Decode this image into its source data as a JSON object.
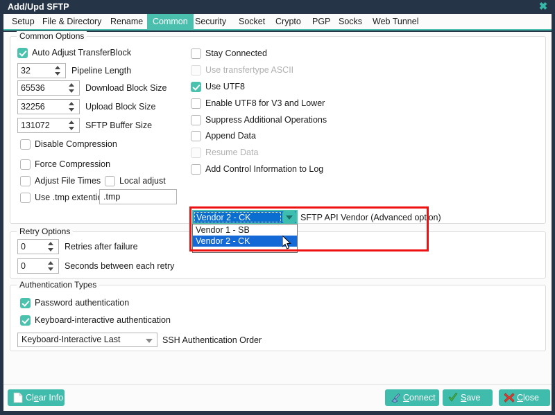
{
  "window": {
    "title": "Add/Upd SFTP",
    "close_icon": "close-x-icon"
  },
  "tabs": [
    {
      "label": "Setup",
      "active": false
    },
    {
      "label": "File & Directory",
      "active": false
    },
    {
      "label": "Rename",
      "active": false
    },
    {
      "label": "Common",
      "active": true
    },
    {
      "label": "Security",
      "active": false
    },
    {
      "label": "Socket",
      "active": false
    },
    {
      "label": "Crypto",
      "active": false
    },
    {
      "label": "PGP",
      "active": false
    },
    {
      "label": "Socks",
      "active": false
    },
    {
      "label": "Web Tunnel",
      "active": false
    }
  ],
  "common_options": {
    "title": "Common Options",
    "left": {
      "auto_adjust": {
        "label": "Auto Adjust TransferBlock",
        "checked": true,
        "disabled": false
      },
      "pipeline_length": {
        "label": "Pipeline Length",
        "value": "32"
      },
      "download_block_size": {
        "label": "Download Block Size",
        "value": "65536"
      },
      "upload_block_size": {
        "label": "Upload Block Size",
        "value": "32256"
      },
      "sftp_buffer_size": {
        "label": "SFTP Buffer Size",
        "value": "131072"
      },
      "disable_compression": {
        "label": "Disable Compression",
        "checked": false,
        "disabled": false
      },
      "force_compression": {
        "label": "Force Compression",
        "checked": false,
        "disabled": false
      },
      "adjust_file_times": {
        "label": "Adjust File Times",
        "checked": false,
        "disabled": false
      },
      "local_adjust": {
        "label": "Local adjust",
        "checked": false,
        "disabled": false
      },
      "use_tmp_extention": {
        "label": "Use .tmp extention",
        "checked": false,
        "disabled": false
      },
      "tmp_value": ".tmp"
    },
    "right": {
      "stay_connected": {
        "label": "Stay Connected",
        "checked": false,
        "disabled": false
      },
      "use_transfertype_ascii": {
        "label": "Use transfertype ASCII",
        "checked": false,
        "disabled": true
      },
      "use_utf8": {
        "label": "Use UTF8",
        "checked": true,
        "disabled": false
      },
      "enable_utf8_v3": {
        "label": "Enable UTF8 for V3 and Lower",
        "checked": false,
        "disabled": false
      },
      "suppress_additional": {
        "label": "Suppress Additional Operations",
        "checked": false,
        "disabled": false
      },
      "append_data": {
        "label": "Append Data",
        "checked": false,
        "disabled": false
      },
      "resume_data": {
        "label": "Resume Data",
        "checked": false,
        "disabled": true
      },
      "add_control_info": {
        "label": "Add Control Information to Log",
        "checked": false,
        "disabled": false
      }
    },
    "vendor": {
      "label": "SFTP API Vendor (Advanced option)",
      "selected": "Vendor 2 - CK",
      "expanded": true,
      "options": [
        {
          "label": "Vendor 1 - SB",
          "selected": false
        },
        {
          "label": "Vendor 2 - CK",
          "selected": true
        }
      ]
    }
  },
  "retry_options": {
    "title": "Retry Options",
    "retries_after_failure": {
      "label": "Retries after failure",
      "value": "0"
    },
    "seconds_between_retry": {
      "label": "Seconds between each retry",
      "value": "0"
    }
  },
  "authentication_types": {
    "title": "Authentication Types",
    "password_authentication": {
      "label": "Password authentication",
      "checked": true
    },
    "keyboard_interactive_authentication": {
      "label": "Keyboard-interactive authentication",
      "checked": true
    },
    "ssh_auth_order": {
      "label": "SSH Authentication Order",
      "selected": "Keyboard-Interactive Last",
      "options": [
        "Keyboard-Interactive Last"
      ]
    }
  },
  "footer": {
    "clear_info": {
      "label": "Clear Info",
      "icon": "document-icon"
    },
    "connect": {
      "label": "Connect",
      "icon": "plug-icon"
    },
    "save": {
      "label": "Save",
      "icon": "check-icon"
    },
    "close": {
      "label": "Close",
      "icon": "x-icon"
    }
  },
  "colors": {
    "accent": "#4bbfae",
    "titlebar": "#263448",
    "annotation": "#ee1111",
    "selection": "#1569d6"
  }
}
